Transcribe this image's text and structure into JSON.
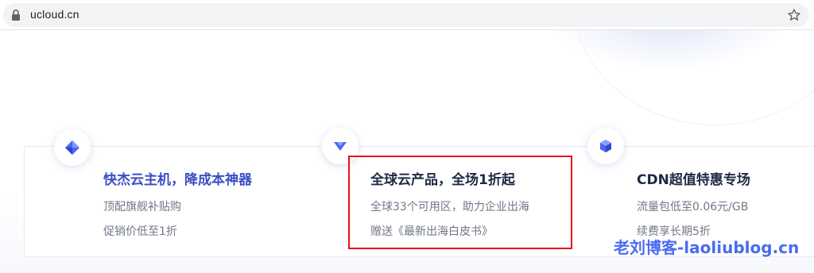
{
  "browser": {
    "url": "ucloud.cn",
    "icons": {
      "lock": "lock-icon",
      "bookmark": "star-icon"
    }
  },
  "promos": [
    {
      "icon": "diamond-icon",
      "title": "快杰云主机，降成本神器",
      "line1": "顶配旗舰补贴购",
      "line2": "促销价低至1折"
    },
    {
      "icon": "triangle-icon",
      "title": "全球云产品，全场1折起",
      "line1": "全球33个可用区，助力企业出海",
      "line2": "赠送《最新出海白皮书》"
    },
    {
      "icon": "cube-icon",
      "title": "CDN超值特惠专场",
      "line1": "流量包低至0.06元/GB",
      "line2": "续费享长期5折"
    }
  ],
  "watermark": "老刘博客-laoliublog.cn",
  "colors": {
    "accent": "#3a4ec4",
    "highlight_border": "#e8101b",
    "watermark": "#4a6cf0"
  }
}
